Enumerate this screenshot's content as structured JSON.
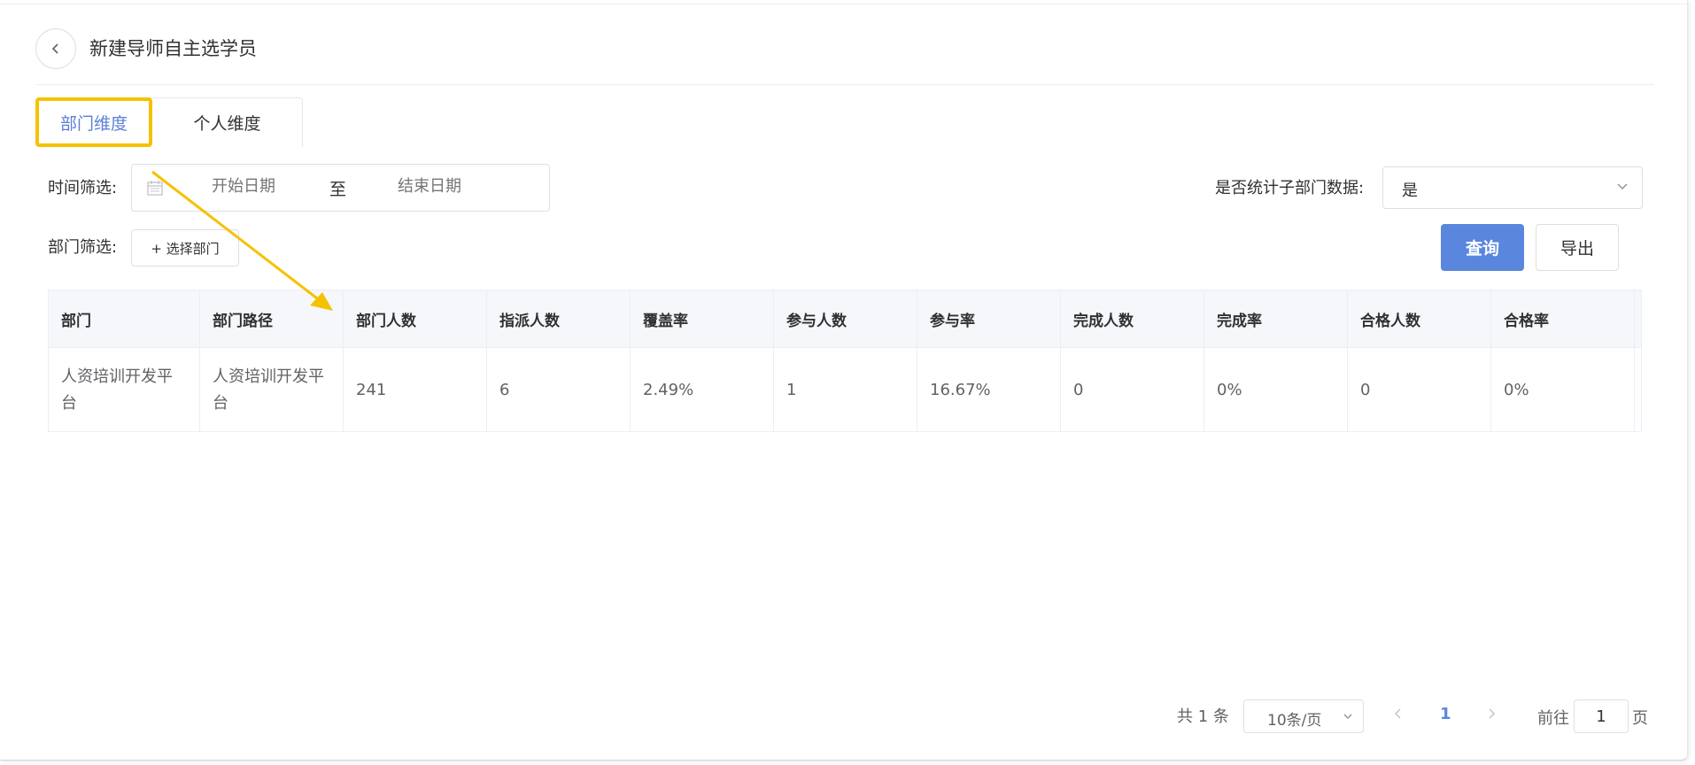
{
  "header": {
    "title": "新建导师自主选学员"
  },
  "tabs": [
    {
      "label": "部门维度",
      "active": true
    },
    {
      "label": "个人维度",
      "active": false
    }
  ],
  "filters": {
    "time_label": "时间筛选:",
    "date_start_placeholder": "开始日期",
    "date_separator": "至",
    "date_end_placeholder": "结束日期",
    "sub_dept_label": "是否统计子部门数据:",
    "sub_dept_value": "是",
    "dept_label": "部门筛选:",
    "choose_dept_button": "+ 选择部门"
  },
  "actions": {
    "query_label": "查询",
    "export_label": "导出"
  },
  "table": {
    "columns": [
      "部门",
      "部门路径",
      "部门人数",
      "指派人数",
      "覆盖率",
      "参与人数",
      "参与率",
      "完成人数",
      "完成率",
      "合格人数",
      "合格率"
    ],
    "rows": [
      [
        "人资培训开发平台",
        "人资培训开发平台",
        "241",
        "6",
        "2.49%",
        "1",
        "16.67%",
        "0",
        "0%",
        "0",
        "0%"
      ]
    ]
  },
  "pagination": {
    "total_text": "共 1 条",
    "page_size": "10条/页",
    "current_page": "1",
    "goto_label": "前往",
    "goto_value": "1",
    "page_suffix": "页"
  },
  "colors": {
    "accent": "#5b86de",
    "highlight": "#f5c200"
  },
  "icons": {
    "back": "chevron-left-icon",
    "calendar": "calendar-icon",
    "dropdown": "chevron-down-icon"
  }
}
